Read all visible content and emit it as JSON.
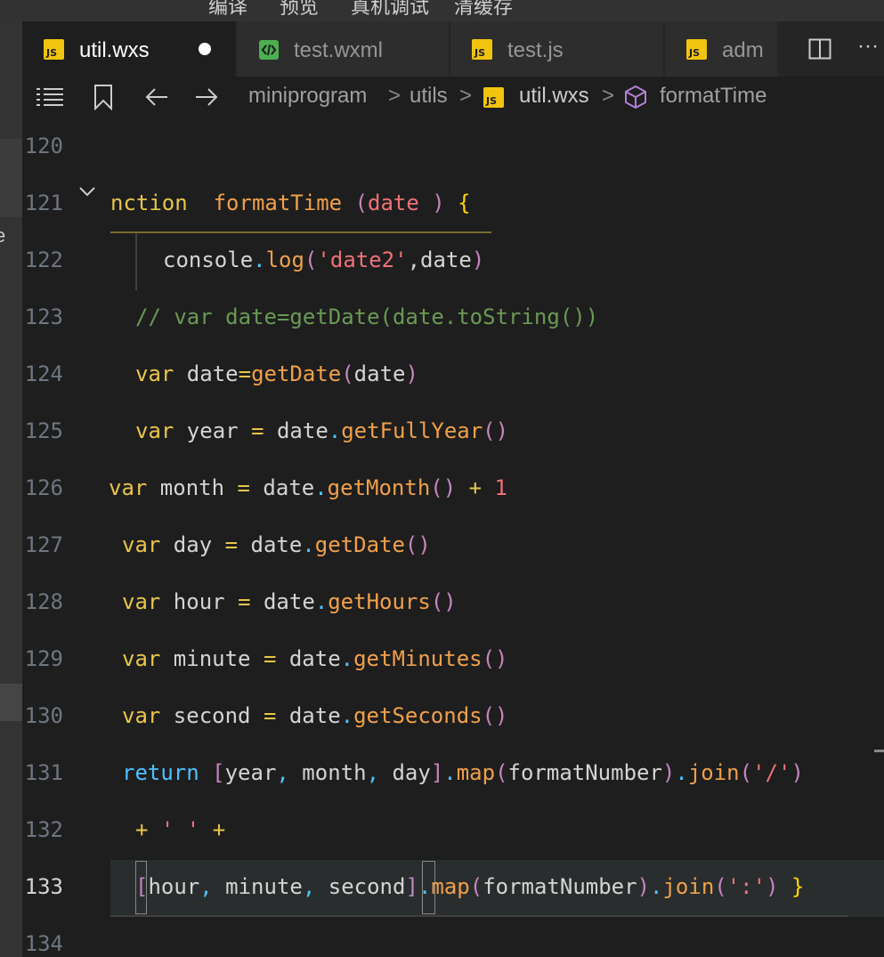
{
  "menubar": {
    "items": [
      "编译",
      "预览",
      "真机调试",
      "清缓存"
    ]
  },
  "left_strip": {
    "cut_text": "e"
  },
  "tabs": [
    {
      "label": "util.wxs",
      "icon": "js-file-icon",
      "active": true,
      "modified": true
    },
    {
      "label": "test.wxml",
      "icon": "wxml-file-icon",
      "active": false
    },
    {
      "label": "test.js",
      "icon": "js-file-icon",
      "active": false
    },
    {
      "label": "adm",
      "icon": "js-file-icon",
      "active": false
    }
  ],
  "icon_text": {
    "js": "JS"
  },
  "tab_actions": {
    "split": "split-editor-icon",
    "more": "more-actions-icon",
    "more_glyph": "···"
  },
  "breadcrumb": {
    "parts": [
      "miniprogram",
      "utils",
      "util.wxs",
      "formatTime"
    ],
    "separator": ">"
  },
  "editor": {
    "current_line": 133,
    "lines": [
      {
        "n": "120",
        "parts": []
      },
      {
        "n": "121",
        "parts": [
          [
            "kw",
            "nction"
          ],
          [
            "dtxt",
            "  "
          ],
          [
            "fn",
            "formatTime"
          ],
          [
            "dtxt",
            " "
          ],
          [
            "par",
            "("
          ],
          [
            "pm",
            "date"
          ],
          [
            "dtxt",
            " "
          ],
          [
            "par",
            ")"
          ],
          [
            "dtxt",
            " "
          ],
          [
            "brace",
            "{"
          ]
        ]
      },
      {
        "n": "122",
        "parts": [
          [
            "dtxt",
            "console"
          ],
          [
            "blue",
            "."
          ],
          [
            "fn",
            "log"
          ],
          [
            "par",
            "("
          ],
          [
            "str",
            "'date2'"
          ],
          [
            "dtxt",
            ",date"
          ],
          [
            "par",
            ")"
          ]
        ]
      },
      {
        "n": "123",
        "parts": [
          [
            "cm",
            "// var date=getDate(date.toString())"
          ]
        ]
      },
      {
        "n": "124",
        "parts": [
          [
            "kw",
            "var"
          ],
          [
            "dtxt",
            " date"
          ],
          [
            "op",
            "="
          ],
          [
            "fn",
            "getDate"
          ],
          [
            "par",
            "("
          ],
          [
            "dtxt",
            "date"
          ],
          [
            "par",
            ")"
          ]
        ]
      },
      {
        "n": "125",
        "parts": [
          [
            "kw",
            "var"
          ],
          [
            "dtxt",
            " year "
          ],
          [
            "op",
            "="
          ],
          [
            "dtxt",
            " date"
          ],
          [
            "blue",
            "."
          ],
          [
            "fn",
            "getFullYear"
          ],
          [
            "par",
            "()"
          ]
        ]
      },
      {
        "n": "126",
        "parts": [
          [
            "kw",
            "var"
          ],
          [
            "dtxt",
            " month "
          ],
          [
            "op",
            "="
          ],
          [
            "dtxt",
            " date"
          ],
          [
            "blue",
            "."
          ],
          [
            "fn",
            "getMonth"
          ],
          [
            "par",
            "()"
          ],
          [
            "dtxt",
            " "
          ],
          [
            "op",
            "+"
          ],
          [
            "dtxt",
            " "
          ],
          [
            "num",
            "1"
          ]
        ]
      },
      {
        "n": "127",
        "parts": [
          [
            "kw",
            "var"
          ],
          [
            "dtxt",
            " day "
          ],
          [
            "op",
            "="
          ],
          [
            "dtxt",
            " date"
          ],
          [
            "blue",
            "."
          ],
          [
            "fn",
            "getDate"
          ],
          [
            "par",
            "()"
          ]
        ]
      },
      {
        "n": "128",
        "parts": [
          [
            "kw",
            "var"
          ],
          [
            "dtxt",
            " hour "
          ],
          [
            "op",
            "="
          ],
          [
            "dtxt",
            " date"
          ],
          [
            "blue",
            "."
          ],
          [
            "fn",
            "getHours"
          ],
          [
            "par",
            "()"
          ]
        ]
      },
      {
        "n": "129",
        "parts": [
          [
            "kw",
            "var"
          ],
          [
            "dtxt",
            " minute "
          ],
          [
            "op",
            "="
          ],
          [
            "dtxt",
            " date"
          ],
          [
            "blue",
            "."
          ],
          [
            "fn",
            "getMinutes"
          ],
          [
            "par",
            "()"
          ]
        ]
      },
      {
        "n": "130",
        "parts": [
          [
            "kw",
            "var"
          ],
          [
            "dtxt",
            " second "
          ],
          [
            "op",
            "="
          ],
          [
            "dtxt",
            " date"
          ],
          [
            "blue",
            "."
          ],
          [
            "fn",
            "getSeconds"
          ],
          [
            "par",
            "()"
          ]
        ]
      },
      {
        "n": "131",
        "parts": [
          [
            "kw2",
            "return"
          ],
          [
            "dtxt",
            " "
          ],
          [
            "par",
            "["
          ],
          [
            "dtxt",
            "year"
          ],
          [
            "blue",
            ","
          ],
          [
            "dtxt",
            " month"
          ],
          [
            "blue",
            ","
          ],
          [
            "dtxt",
            " day"
          ],
          [
            "par",
            "]"
          ],
          [
            "blue",
            "."
          ],
          [
            "fn",
            "map"
          ],
          [
            "par",
            "("
          ],
          [
            "dtxt",
            "formatNumber"
          ],
          [
            "par",
            ")"
          ],
          [
            "blue",
            "."
          ],
          [
            "fn",
            "join"
          ],
          [
            "par",
            "("
          ],
          [
            "str",
            "'/'"
          ],
          [
            "par",
            ")"
          ]
        ]
      },
      {
        "n": "132",
        "parts": [
          [
            "op",
            "+"
          ],
          [
            "dtxt",
            " "
          ],
          [
            "str",
            "' '"
          ],
          [
            "dtxt",
            " "
          ],
          [
            "op",
            "+"
          ]
        ]
      },
      {
        "n": "133",
        "parts": [
          [
            "par",
            "["
          ],
          [
            "dtxt",
            "hour"
          ],
          [
            "blue",
            ","
          ],
          [
            "dtxt",
            " minute"
          ],
          [
            "blue",
            ","
          ],
          [
            "dtxt",
            " second"
          ],
          [
            "par",
            "]"
          ],
          [
            "blue",
            "."
          ],
          [
            "fn",
            "map"
          ],
          [
            "par",
            "("
          ],
          [
            "dtxt",
            "formatNumber"
          ],
          [
            "par",
            ")"
          ],
          [
            "blue",
            "."
          ],
          [
            "fn",
            "join"
          ],
          [
            "par",
            "("
          ],
          [
            "str",
            "':'"
          ],
          [
            "par",
            ")"
          ],
          [
            "dtxt",
            " "
          ],
          [
            "brace",
            "}"
          ]
        ]
      },
      {
        "n": "134",
        "parts": []
      }
    ]
  },
  "colors": {
    "editor_bg": "#1e1e1e",
    "keyword": "#e8c54a",
    "function": "#f0a04b",
    "string": "#f07178",
    "comment": "#6a9955",
    "bracket": "#c586c0",
    "accent_js": "#f1c40f"
  }
}
